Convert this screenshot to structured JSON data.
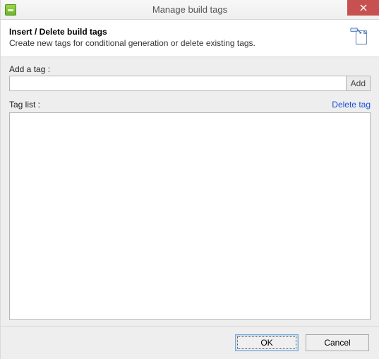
{
  "window": {
    "title": "Manage build tags"
  },
  "header": {
    "title": "Insert / Delete build tags",
    "subtitle": "Create new tags for conditional generation or delete existing tags."
  },
  "body": {
    "add_label": "Add a tag :",
    "add_input_value": "",
    "add_button": "Add",
    "list_label": "Tag list :",
    "delete_link": "Delete tag",
    "tags": []
  },
  "footer": {
    "ok": "OK",
    "cancel": "Cancel"
  }
}
